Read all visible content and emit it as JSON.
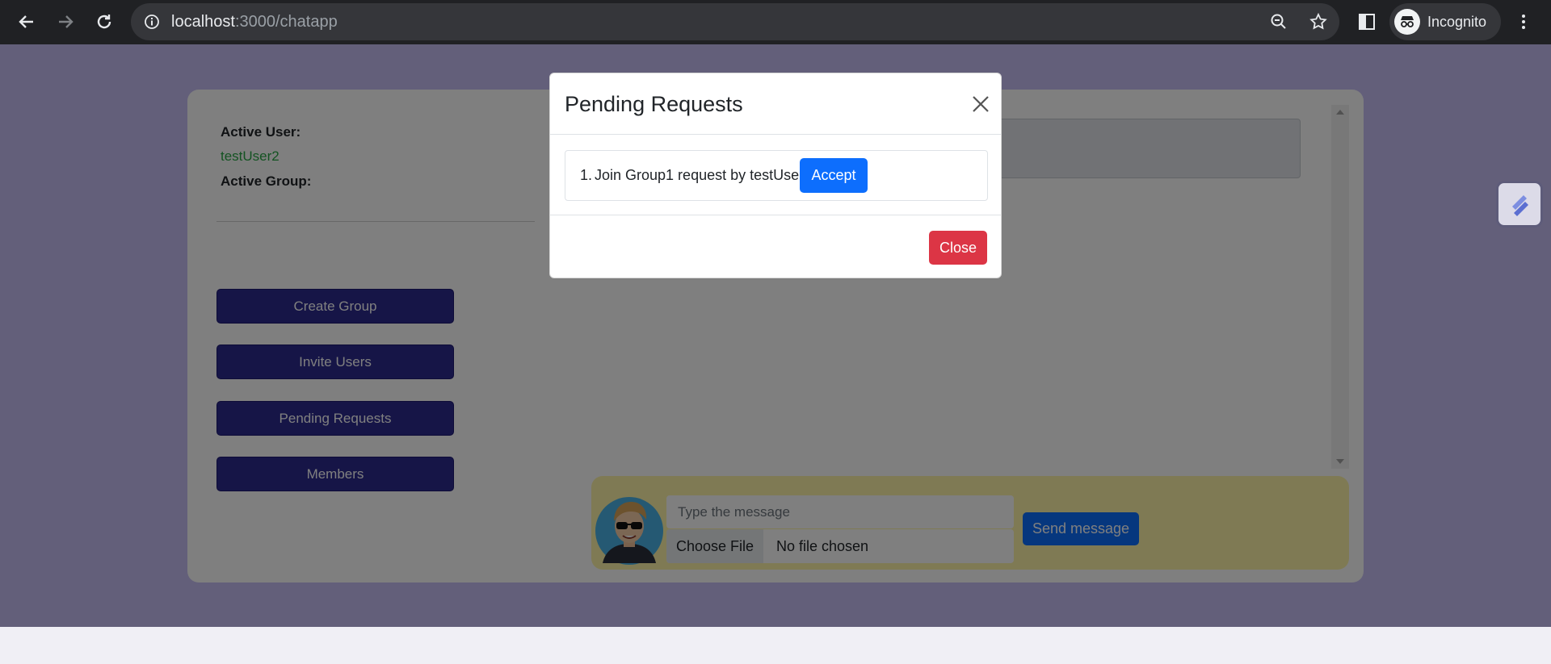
{
  "browser": {
    "url_host": "localhost",
    "url_path": ":3000/chatapp",
    "profile_label": "Incognito"
  },
  "sidebar": {
    "active_user_label": "Active User:",
    "active_user_name": "testUser2",
    "active_group_label": "Active Group:",
    "buttons": {
      "create_group": "Create Group",
      "invite_users": "Invite Users",
      "pending_requests": "Pending Requests",
      "members": "Members"
    }
  },
  "composer": {
    "message_placeholder": "Type the message",
    "choose_file": "Choose File",
    "file_status": "No file chosen",
    "send_label": "Send message"
  },
  "modal": {
    "title": "Pending Requests",
    "requests": [
      {
        "number": "1.",
        "text": "Join Group1 request by testUser",
        "action": "Accept"
      }
    ],
    "close_label": "Close"
  },
  "colors": {
    "page_bg": "#c6bef5",
    "sidebar_button": "#2d2a8f",
    "active_user": "#28a745",
    "primary": "#0d6efd",
    "danger": "#dc3545",
    "composer_bg": "#fff5a8"
  }
}
